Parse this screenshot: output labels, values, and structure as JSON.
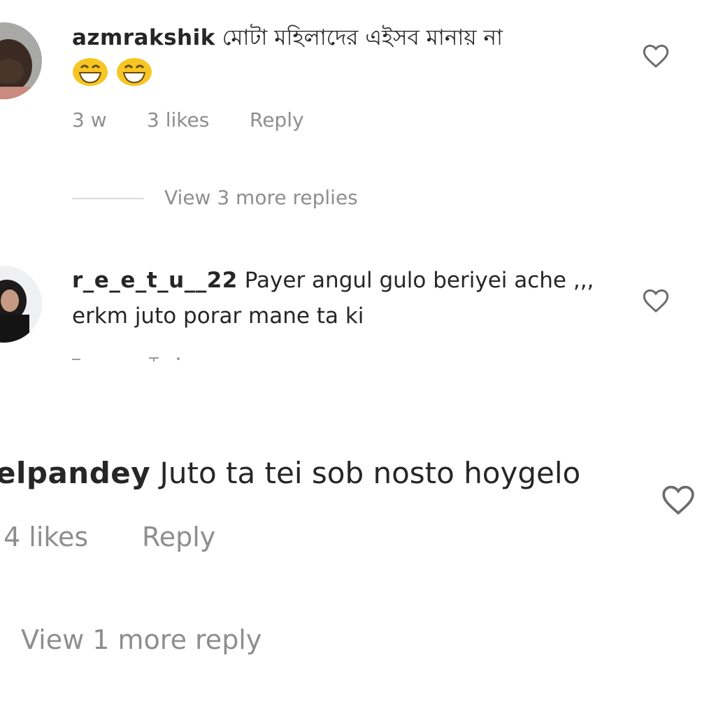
{
  "comments": [
    {
      "username": "azmrakshik",
      "text": "মোটা মহিলাদের এইসব মানায় না",
      "emojis": [
        "grinning-squinting-face",
        "grinning-squinting-face"
      ],
      "time": "3 w",
      "likes": "3 likes",
      "reply_label": "Reply",
      "view_replies": "View 3 more replies"
    },
    {
      "username": "r_e_e_t_u__22",
      "text_line1": "Payer angul gulo beriyei ache ,,,",
      "text_line2": "erkm juto porar mane ta ki"
    },
    {
      "username": "elpandey",
      "text": "Juto ta tei sob nosto hoygelo",
      "likes": "4 likes",
      "reply_label": "Reply",
      "view_replies": "View 1 more reply"
    }
  ],
  "icons": {
    "like": "heart-outline-icon"
  },
  "colors": {
    "text": "#262626",
    "meta": "#8e8e8e",
    "divider": "#dbdbdb",
    "emoji": "#f6c623"
  }
}
